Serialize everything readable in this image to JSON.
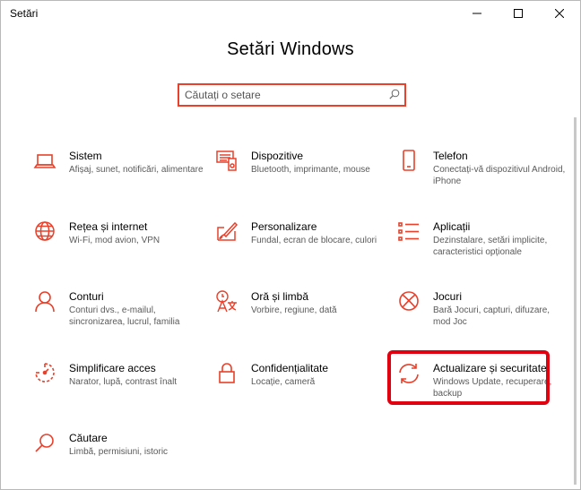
{
  "window": {
    "title": "Setări",
    "controls": {
      "minimize": "minimize-icon",
      "maximize": "maximize-icon",
      "close": "close-icon"
    }
  },
  "header": {
    "title": "Setări Windows"
  },
  "search": {
    "placeholder": "Căutați o setare",
    "icon": "search-icon"
  },
  "colors": {
    "accent": "#e8402a",
    "highlight": "#e00010"
  },
  "tiles": [
    {
      "title": "Sistem",
      "desc": "Afișaj, sunet, notificări, alimentare",
      "icon": "laptop-icon"
    },
    {
      "title": "Dispozitive",
      "desc": "Bluetooth, imprimante, mouse",
      "icon": "devices-icon"
    },
    {
      "title": "Telefon",
      "desc": "Conectați-vă dispozitivul Android, iPhone",
      "icon": "phone-icon"
    },
    {
      "title": "Rețea și internet",
      "desc": "Wi-Fi, mod avion, VPN",
      "icon": "globe-icon"
    },
    {
      "title": "Personalizare",
      "desc": "Fundal, ecran de blocare, culori",
      "icon": "paintbrush-icon"
    },
    {
      "title": "Aplicații",
      "desc": "Dezinstalare, setări implicite, caracteristici opționale",
      "icon": "apps-list-icon"
    },
    {
      "title": "Conturi",
      "desc": "Conturi dvs., e-mailul, sincronizarea, lucrul, familia",
      "icon": "person-icon"
    },
    {
      "title": "Oră și limbă",
      "desc": "Vorbire, regiune, dată",
      "icon": "time-language-icon"
    },
    {
      "title": "Jocuri",
      "desc": "Bară Jocuri, capturi, difuzare, mod Joc",
      "icon": "xbox-icon"
    },
    {
      "title": "Simplificare acces",
      "desc": "Narator, lupă, contrast înalt",
      "icon": "ease-of-access-icon"
    },
    {
      "title": "Confidențialitate",
      "desc": "Locație, cameră",
      "icon": "lock-icon"
    },
    {
      "title": "Actualizare și securitate",
      "desc": "Windows Update, recuperare, backup",
      "icon": "update-icon"
    },
    {
      "title": "Căutare",
      "desc": "Limbă, permisiuni, istoric",
      "icon": "search-icon"
    }
  ]
}
